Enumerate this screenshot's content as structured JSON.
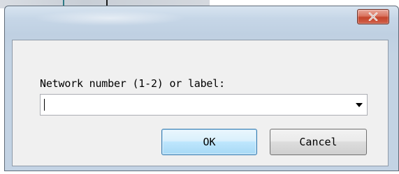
{
  "dialog": {
    "close_label": "X",
    "prompt": "Network number (1-2) or label:",
    "input": {
      "value": "",
      "placeholder": ""
    },
    "buttons": {
      "ok": "OK",
      "cancel": "Cancel"
    }
  },
  "colors": {
    "close_button": "#c4452c",
    "ok_border": "#3c7fb1",
    "frame": "#c3d3e4",
    "client": "#f0f0f0"
  },
  "icons": {
    "close": "close-icon",
    "dropdown": "chevron-down-icon"
  }
}
